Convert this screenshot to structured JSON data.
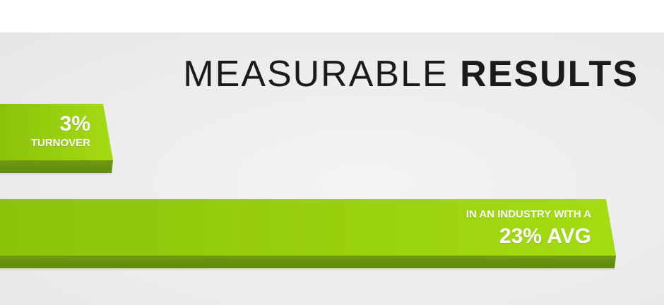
{
  "title": {
    "light": "MEASURABLE",
    "bold": "RESULTS"
  },
  "colors": {
    "bar_top": "#a4dc12",
    "bar_top_alt": "#8cc20a",
    "bar_edge": "#6f9a10",
    "bar_side": "#5f8a0c",
    "title": "#1b1b1b"
  },
  "chart_data": {
    "type": "bar",
    "orientation": "horizontal",
    "categories": [
      "TURNOVER",
      "INDUSTRY AVG"
    ],
    "values": [
      3,
      23
    ],
    "unit": "%",
    "labels": [
      {
        "value_text": "3%",
        "caption": "TURNOVER"
      },
      {
        "caption": "IN AN INDUSTRY WITH A",
        "value_text": "23% AVG"
      }
    ]
  }
}
